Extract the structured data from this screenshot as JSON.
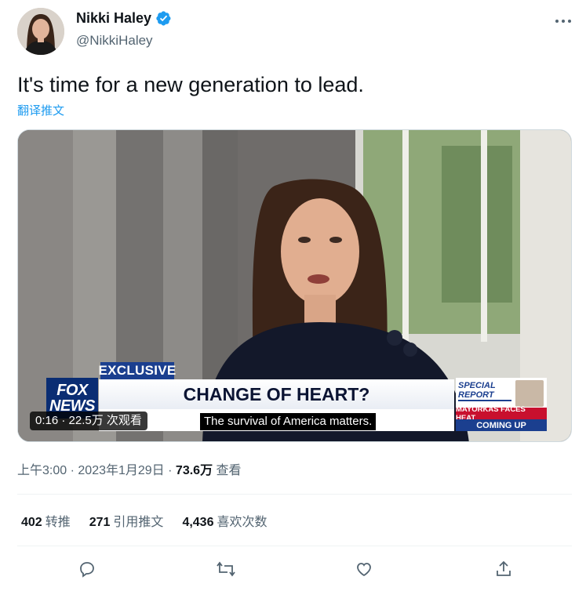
{
  "author": {
    "display_name": "Nikki Haley",
    "handle": "@NikkiHaley",
    "verified_icon": "verified-badge-icon",
    "verified_color": "#1d9bf0"
  },
  "tweet": {
    "text": "It's time for a new generation to lead.",
    "translate_label": "翻译推文"
  },
  "video": {
    "banner_exclusive": "EXCLUSIVE",
    "logo_line1": "FOX",
    "logo_line2": "NEWS",
    "headline": "CHANGE OF HEART?",
    "caption": "The survival of America matters.",
    "special_line1": "SPECIAL",
    "special_line2": "REPORT",
    "special_red": "MAYORKAS FACES HEAT",
    "special_blue": "COMING UP",
    "time_views": "0:16 · 22.5万 次观看"
  },
  "meta": {
    "time": "上午3:00",
    "separator": "·",
    "date": "2023年1月29日",
    "views_count": "73.6万",
    "views_label": "查看"
  },
  "stats": {
    "retweets_count": "402",
    "retweets_label": "转推",
    "quotes_count": "271",
    "quotes_label": "引用推文",
    "likes_count": "4,436",
    "likes_label": "喜欢次数"
  },
  "actions": [
    "reply-icon",
    "retweet-icon",
    "like-icon",
    "share-icon"
  ],
  "colors": {
    "accent": "#1d9bf0",
    "secondary_text": "#536471",
    "fox_blue": "#1b3f8f",
    "fox_red": "#c8102e"
  }
}
